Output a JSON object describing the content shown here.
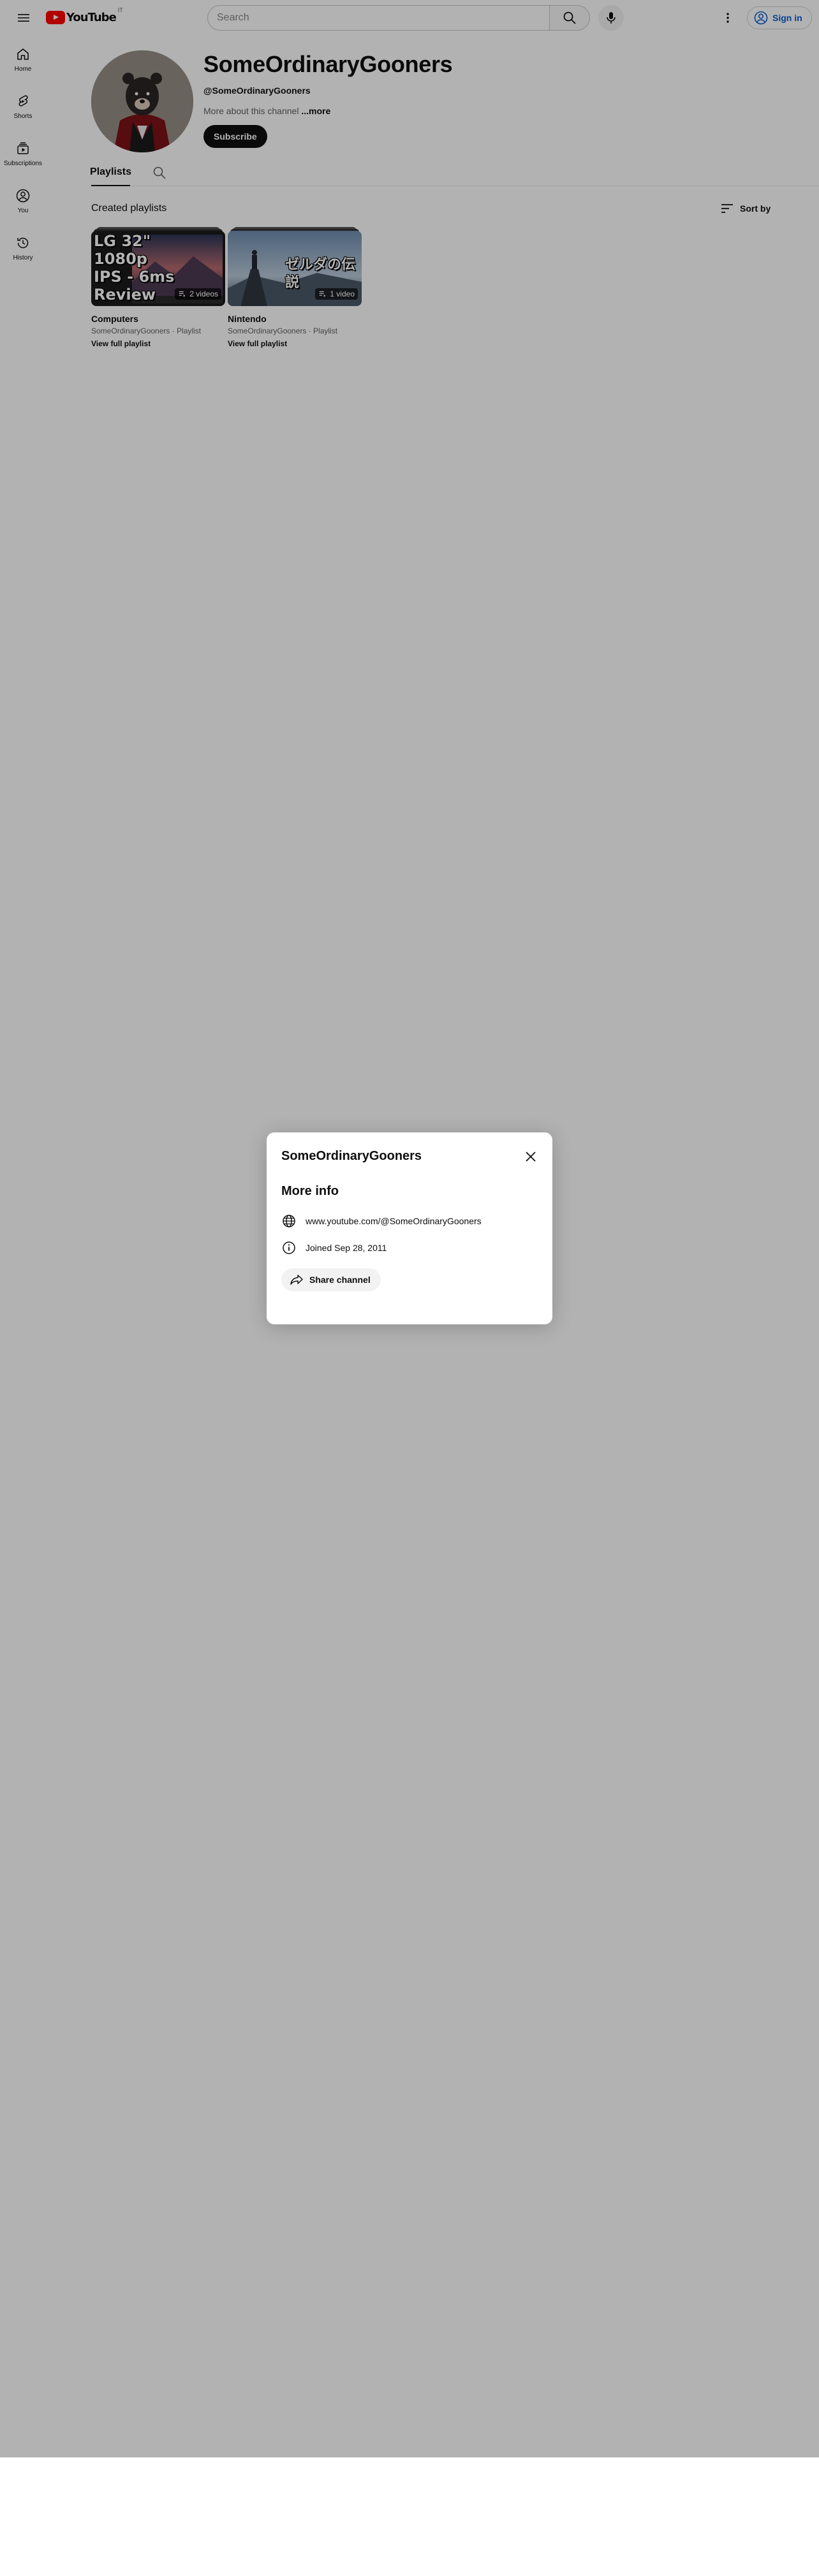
{
  "header": {
    "logo_text": "YouTube",
    "logo_region": "IT",
    "search_placeholder": "Search",
    "signin_label": "Sign in"
  },
  "guide": {
    "items": [
      {
        "label": "Home",
        "icon": "home-icon"
      },
      {
        "label": "Shorts",
        "icon": "shorts-icon"
      },
      {
        "label": "Subscriptions",
        "icon": "subscriptions-icon"
      },
      {
        "label": "You",
        "icon": "you-icon"
      },
      {
        "label": "History",
        "icon": "history-icon"
      }
    ]
  },
  "channel": {
    "title": "SomeOrdinaryGooners",
    "handle": "@SomeOrdinaryGooners",
    "description": "More about this channel",
    "more_label": " ...more",
    "subscribe_label": "Subscribe"
  },
  "tabs": {
    "playlists_label": "Playlists"
  },
  "shelf": {
    "title": "Created playlists",
    "sort_label": "Sort by"
  },
  "playlists": [
    {
      "title": "Computers",
      "meta": "SomeOrdinaryGooners · Playlist",
      "view_label": "View full playlist",
      "count": "2 videos",
      "thumb_text": [
        "LG 32\"",
        "1080p",
        "IPS - 6ms",
        "Review"
      ]
    },
    {
      "title": "Nintendo",
      "meta": "SomeOrdinaryGooners · Playlist",
      "view_label": "View full playlist",
      "count": "1 video",
      "thumb_text": [
        "ゼルダの伝説"
      ]
    }
  ],
  "dialog": {
    "title": "SomeOrdinaryGooners",
    "heading": "More info",
    "link": "www.youtube.com/@SomeOrdinaryGooners",
    "joined": "Joined Sep 28, 2011",
    "share_label": "Share channel"
  },
  "colors": {
    "brand_red": "#ff0000",
    "link_blue": "#065fd4",
    "scrim": "rgba(0,0,0,0.30)"
  }
}
